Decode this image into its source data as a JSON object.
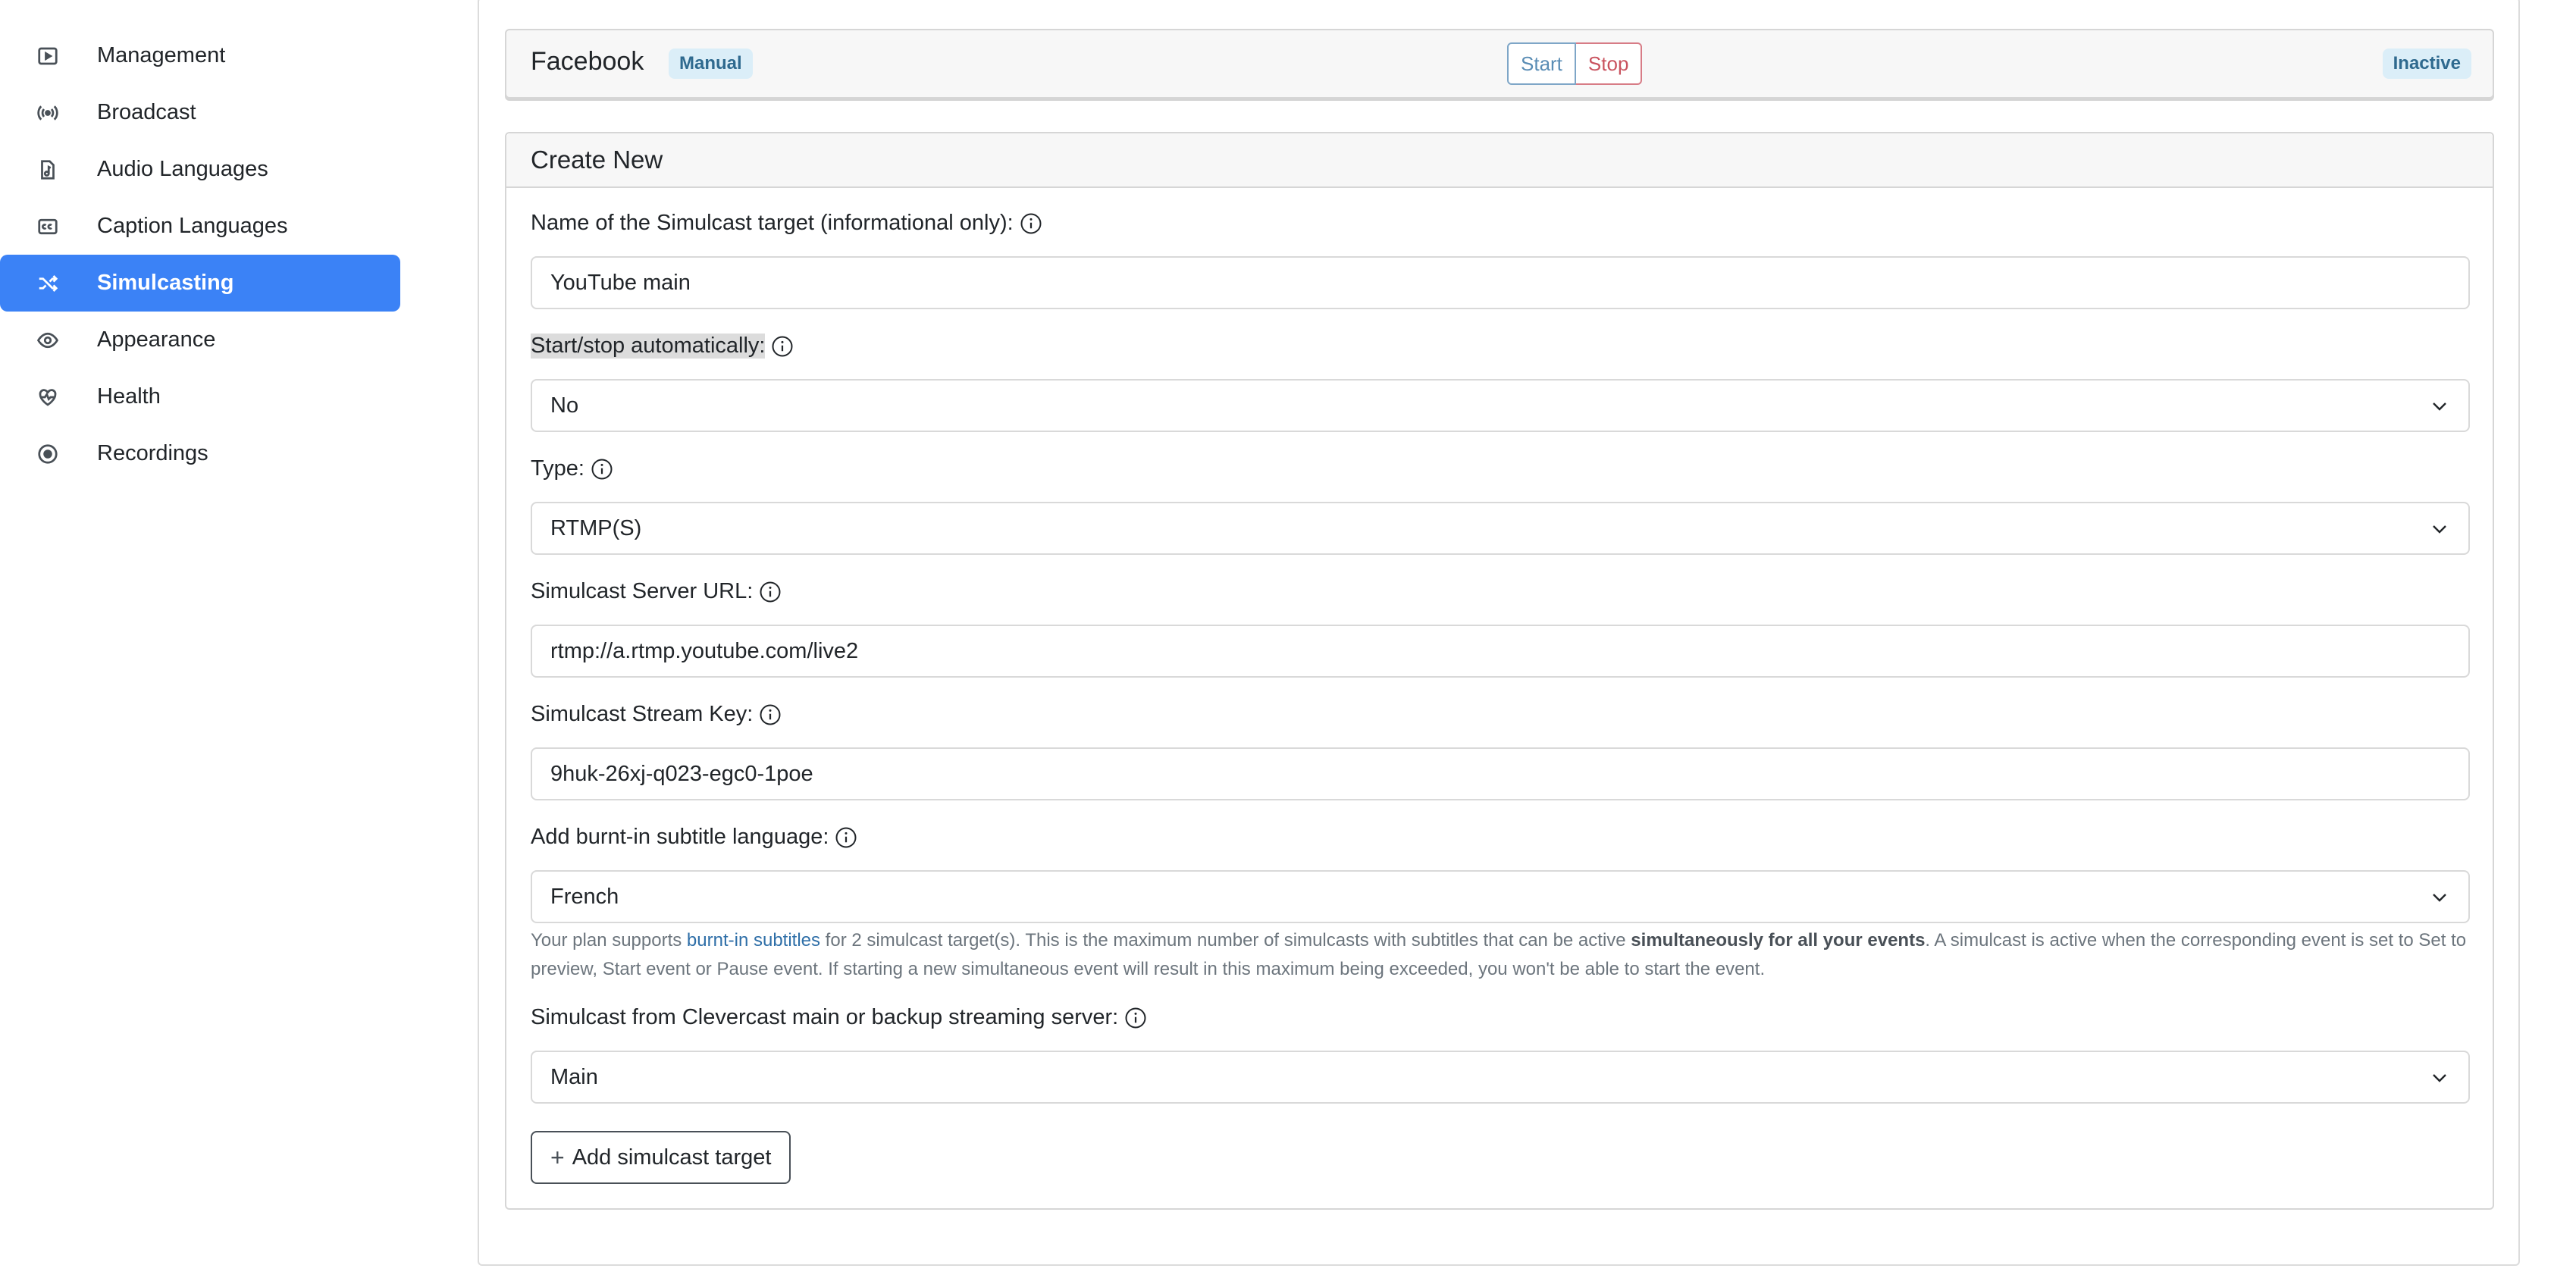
{
  "sidebar": {
    "items": [
      {
        "label": "Management",
        "icon": "play-square-icon",
        "active": false
      },
      {
        "label": "Broadcast",
        "icon": "broadcast-icon",
        "active": false
      },
      {
        "label": "Audio Languages",
        "icon": "music-file-icon",
        "active": false
      },
      {
        "label": "Caption Languages",
        "icon": "cc-icon",
        "active": false
      },
      {
        "label": "Simulcasting",
        "icon": "shuffle-icon",
        "active": true
      },
      {
        "label": "Appearance",
        "icon": "eye-icon",
        "active": false
      },
      {
        "label": "Health",
        "icon": "heart-pulse-icon",
        "active": false
      },
      {
        "label": "Recordings",
        "icon": "record-circle-icon",
        "active": false
      }
    ],
    "active_color": "#3b82f6"
  },
  "facebook_target": {
    "name": "Facebook",
    "mode_badge": "Manual",
    "start_label": "Start",
    "stop_label": "Stop",
    "status_badge": "Inactive"
  },
  "create_new": {
    "title": "Create New",
    "name_label": "Name of the Simulcast target (informational only):",
    "name_value": "YouTube main",
    "auto_label": "Start/stop automatically:",
    "auto_value": "No",
    "type_label": "Type:",
    "type_value": "RTMP(S)",
    "url_label": "Simulcast Server URL:",
    "url_value": "rtmp://a.rtmp.youtube.com/live2",
    "key_label": "Simulcast Stream Key:",
    "key_value": "9huk-26xj-q023-egc0-1poe",
    "subtitle_label": "Add burnt-in subtitle language:",
    "subtitle_value": "French",
    "help": {
      "part1": "Your plan supports ",
      "link": "burnt-in subtitles",
      "part2": " for 2 simulcast target(s). This is the maximum number of simulcasts with subtitles that can be active ",
      "bold": "simultaneously for all your events",
      "part3": ". A simulcast is active when the corresponding event is set to Set to preview, Start event or Pause event. If starting a new simultaneous event will result in this maximum being exceeded, you won't be able to start the event."
    },
    "server_label": "Simulcast from Clevercast main or backup streaming server:",
    "server_value": "Main",
    "add_button": "Add simulcast target"
  }
}
